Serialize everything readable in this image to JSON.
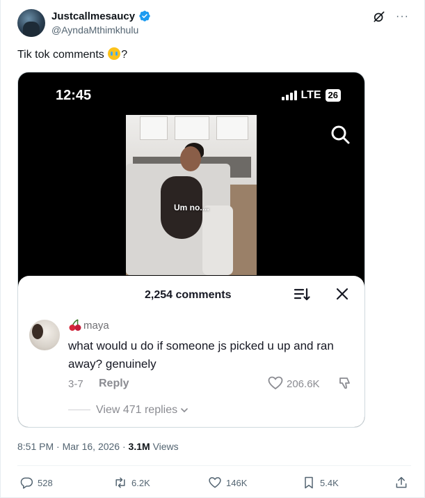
{
  "author": {
    "display_name": "Justcallmesaucy",
    "handle": "@AyndaMthimkhulu"
  },
  "tweet": {
    "text_before_emoji": "Tik tok comments ",
    "emoji": "loudly-crying-face",
    "text_after_emoji": "?"
  },
  "media": {
    "status_bar": {
      "time": "12:45",
      "network": "LTE",
      "battery": "26"
    },
    "video_caption": "Um no....",
    "comments_sheet": {
      "count_label": "2,254 comments",
      "comment": {
        "username": "maya",
        "text": "what would u do if someone js picked u up and ran away? genuinely",
        "date": "3-7",
        "reply_label": "Reply",
        "likes": "206.6K",
        "view_replies": "View 471 replies"
      }
    }
  },
  "meta": {
    "time": "8:51 PM",
    "separator": "·",
    "date": "Mar 16, 2026",
    "views_count": "3.1M",
    "views_label": "Views"
  },
  "actions": {
    "replies": "528",
    "reposts": "6.2K",
    "likes": "146K",
    "bookmarks": "5.4K"
  },
  "colors": {
    "verified_badge": "#1d9bf0",
    "secondary_text": "#536471",
    "primary_text": "#0f1419"
  },
  "icons": [
    "verified-badge-icon",
    "grok-icon",
    "more-icon",
    "search-icon",
    "sort-icon",
    "close-icon",
    "cherry-icon",
    "heart-icon",
    "dislike-icon",
    "chevron-down-icon",
    "reply-icon",
    "repost-icon",
    "like-icon",
    "bookmark-icon",
    "share-icon"
  ]
}
